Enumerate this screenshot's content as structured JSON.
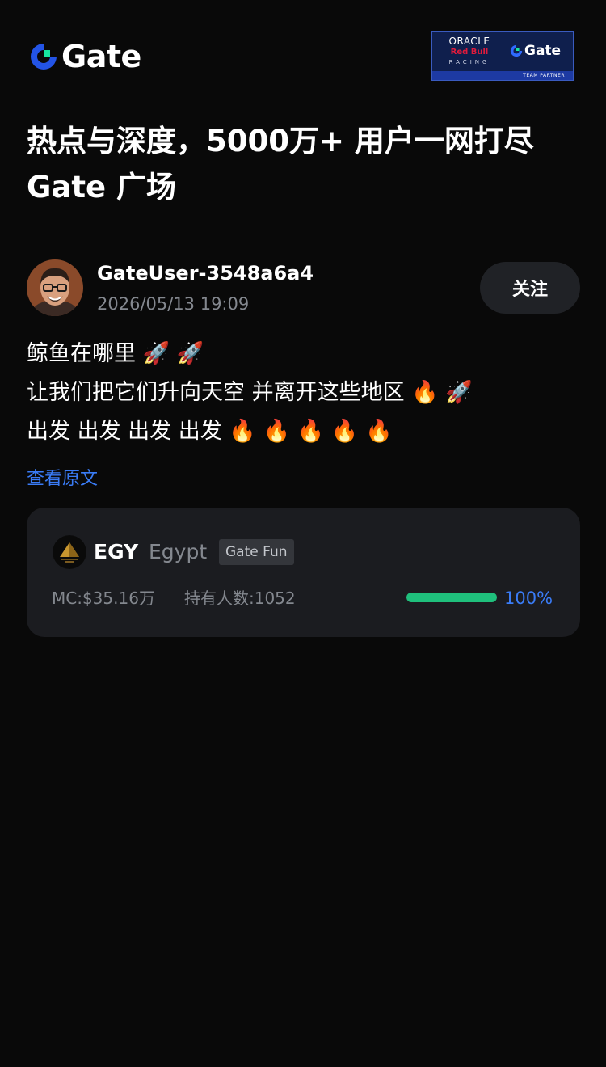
{
  "header": {
    "logo_text": "Gate",
    "partner_badge": {
      "oracle": "ORACLE",
      "redbull": "Red Bull",
      "racing": "RACING",
      "gate": "Gate",
      "team_partner": "TEAM PARTNER"
    }
  },
  "headline": {
    "line1": "热点与深度，5000万+ 用户一网打尽",
    "line2": "Gate 广场"
  },
  "post": {
    "username": "GateUser-3548a6a4",
    "timestamp": "2026/05/13 19:09",
    "follow_label": "关注",
    "lines": [
      "鲸鱼在哪里 🚀 🚀",
      "让我们把它们升向天空 并离开这些地区 🔥 🚀",
      "出发 出发 出发 出发 🔥 🔥 🔥 🔥 🔥"
    ],
    "view_original_label": "查看原文"
  },
  "token_card": {
    "symbol": "EGY",
    "name": "Egypt",
    "tag": "Gate Fun",
    "market_cap": "MC:$35.16万",
    "holders": "持有人数:1052",
    "progress_value": 100,
    "progress_label": "100%"
  },
  "colors": {
    "background": "#090909",
    "card": "#1b1c20",
    "accent_blue": "#3a7cf6",
    "progress_green": "#1fc07c",
    "muted_text": "#84888f",
    "logo_blue": "#2354e6",
    "logo_green": "#17e6a1"
  },
  "icons": {
    "brand": "gate-logo-icon",
    "avatar": "user-avatar",
    "token": "pyramid-token-icon"
  }
}
